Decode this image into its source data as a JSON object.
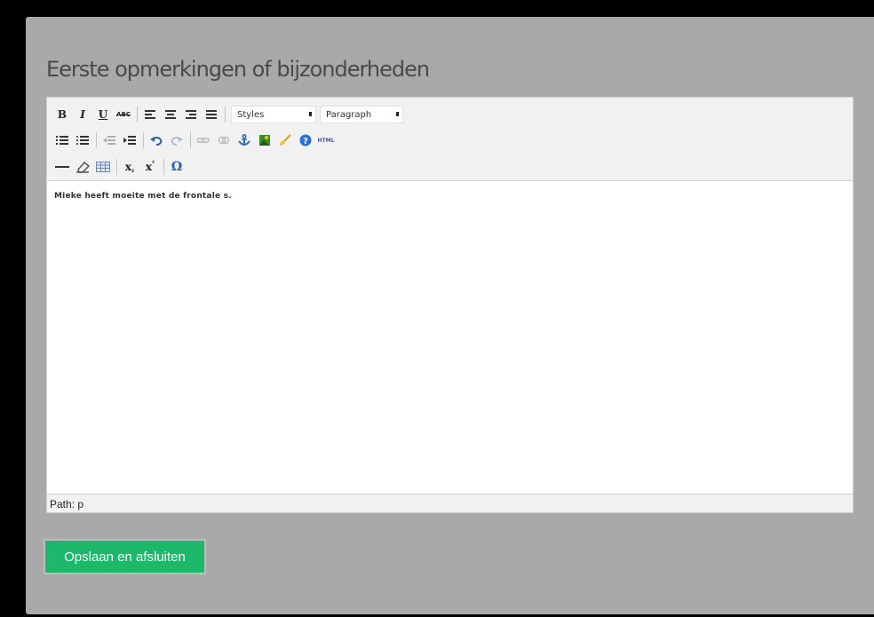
{
  "dialog": {
    "title": "Eerste opmerkingen of bijzonderheden"
  },
  "toolbar": {
    "row1": {
      "bold": "B",
      "italic": "I",
      "underline": "U",
      "strikethrough": "ABC",
      "styles_select": "Styles",
      "format_select": "Paragraph"
    },
    "row2": {
      "html": "HTML"
    },
    "row3": {
      "subscript": "x",
      "superscript": "x",
      "special_char": "Ω"
    }
  },
  "editor": {
    "content": "Mieke heeft moeite met de frontale s."
  },
  "statusbar": {
    "path": "Path: p"
  },
  "actions": {
    "save_label": "Opslaan en afsluiten"
  },
  "colors": {
    "background": "#000000",
    "dialog": "#a9a9a9",
    "save_button": "#1db86a",
    "anchor_icon": "#2a6fb8"
  }
}
